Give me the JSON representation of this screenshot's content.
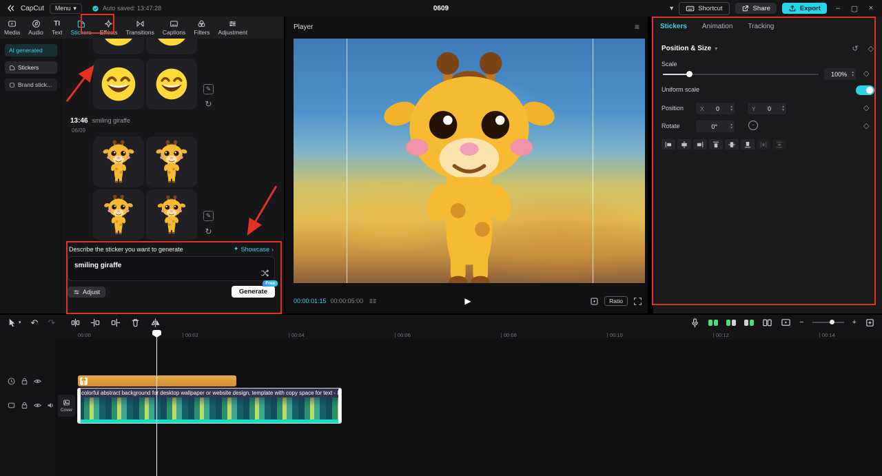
{
  "app": {
    "name": "CapCut",
    "menu": "Menu",
    "autosave": "Auto saved: 13:47:28",
    "title": "0609",
    "shortcut": "Shortcut",
    "share": "Share",
    "export": "Export"
  },
  "left_tabs": [
    "Media",
    "Audio",
    "Text",
    "Stickers",
    "Effects",
    "Transitions",
    "Captions",
    "Filters",
    "Adjustment"
  ],
  "sidebar": {
    "ai": "AI generated",
    "stickers": "Stickers",
    "brand": "Brand stick..."
  },
  "library": {
    "history_time": "13:46",
    "history_prompt": "smiling giraffe",
    "history_date": "06/09"
  },
  "generator": {
    "describe": "Describe the sticker you want to generate",
    "showcase": "Showcase",
    "prompt": "smiling giraffe",
    "adjust": "Adjust",
    "generate": "Generate",
    "free": "Free"
  },
  "player": {
    "title": "Player",
    "current": "00:00:01:15",
    "total": "00:00:05:00",
    "ratio": "Ratio"
  },
  "inspector": {
    "tabs": [
      "Stickers",
      "Animation",
      "Tracking"
    ],
    "section": "Position & Size",
    "scale": "Scale",
    "scale_value": "100%",
    "uniform": "Uniform scale",
    "position": "Position",
    "x": "X",
    "x_value": "0",
    "y": "Y",
    "y_value": "0",
    "rotate": "Rotate",
    "rotate_value": "0°"
  },
  "timeline": {
    "ticks": [
      "00:00",
      "00:02",
      "00:04",
      "00:06",
      "00:08",
      "00:10",
      "00:12",
      "00:14"
    ],
    "cover": "Cover",
    "clip_text": "colorful abstract background for desktop wallpaper or website design, template with copy space for text - Ill"
  },
  "icons": {
    "menu_caret": "▾",
    "undo": "↶",
    "redo": "↷",
    "hamburger": "≡",
    "play": "▶",
    "diamond": "◇",
    "reset": "↺",
    "rotate_cw": "↻",
    "up": "▴",
    "down": "▾",
    "minimize": "–",
    "maximize": "▢",
    "close": "×",
    "chev_right": "›",
    "sparkle": "✦",
    "pencil": "✎",
    "refresh": "↻",
    "minus": "−",
    "plus": "+",
    "text_tab": "TI",
    "sec_caret": "▾"
  },
  "colors": {
    "accent": "#3ed4e2",
    "annotation": "#e13222",
    "clip_orange": "#dc9b3d",
    "audio_teal": "#14dfc4",
    "toggle_on": "#2bd2e2",
    "export_bg": "#25d5e8"
  }
}
